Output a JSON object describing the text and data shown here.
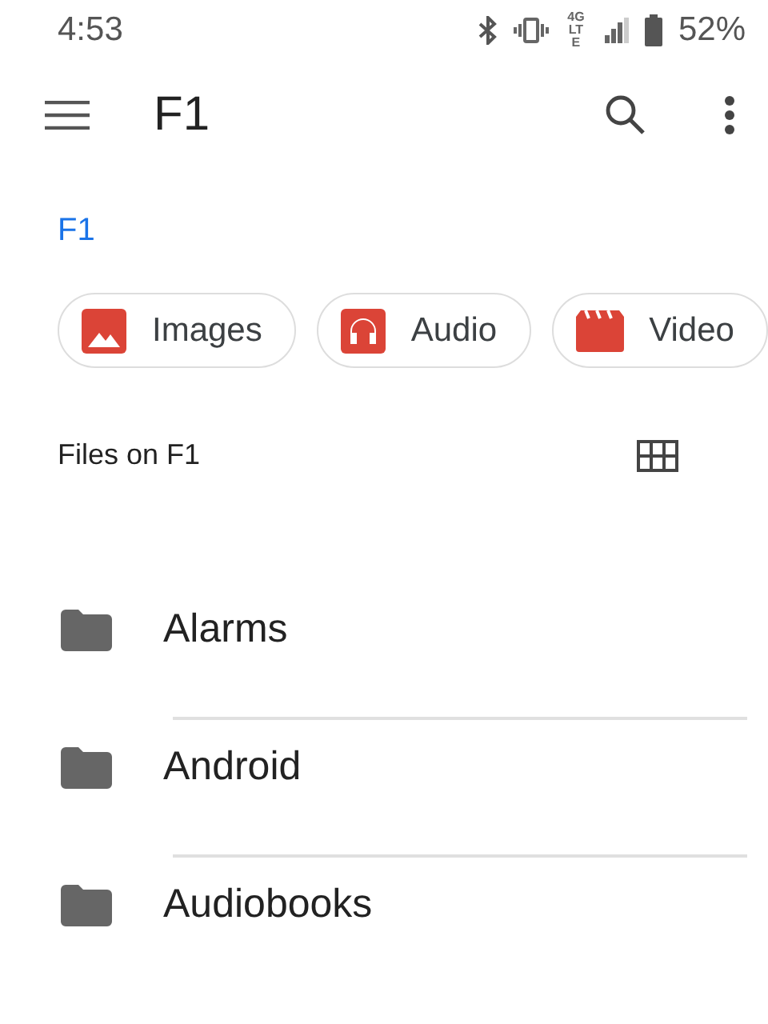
{
  "status_bar": {
    "time": "4:53",
    "network": "4G LTE",
    "battery": "52%"
  },
  "toolbar": {
    "title": "F1"
  },
  "breadcrumb": "F1",
  "chips": [
    {
      "kind": "images",
      "label": "Images"
    },
    {
      "kind": "audio",
      "label": "Audio"
    },
    {
      "kind": "video",
      "label": "Video"
    }
  ],
  "section": {
    "title": "Files on F1"
  },
  "folders": [
    {
      "name": "Alarms"
    },
    {
      "name": "Android"
    },
    {
      "name": "Audiobooks"
    }
  ]
}
